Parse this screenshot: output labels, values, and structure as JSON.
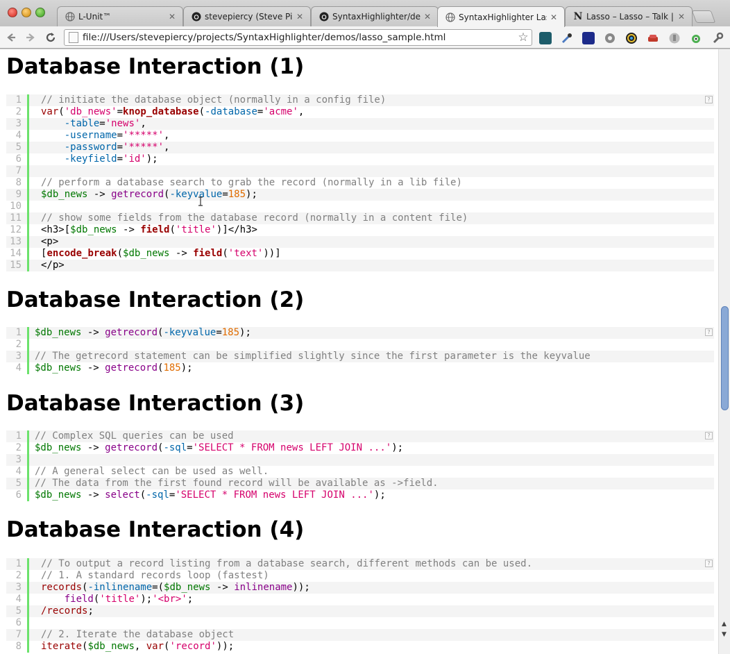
{
  "browser": {
    "tabs": [
      {
        "title": "L-Unit™",
        "icon": "globe-icon"
      },
      {
        "title": "stevepiercy (Steve Piercy)",
        "icon": "github-icon"
      },
      {
        "title": "SyntaxHighlighter/demos",
        "icon": "github-icon"
      },
      {
        "title": "SyntaxHighlighter Lasso",
        "icon": "globe-icon",
        "active": true
      },
      {
        "title": "Lasso – Lasso – Talk | Ma",
        "icon": "n-logo-icon"
      }
    ],
    "url": "file:///Users/stevepiercy/projects/SyntaxHighlighter/demos/lasso_sample.html",
    "close_glyph": "✕",
    "help_glyph": "?"
  },
  "sections": [
    {
      "title": "Database Interaction (1)",
      "lines": [
        [
          [
            "c",
            "// initiate the database object (normally in a config file)"
          ]
        ],
        [
          [
            "k",
            "var"
          ],
          [
            "t",
            "("
          ],
          [
            "s",
            "'db_news'"
          ],
          [
            "t",
            "="
          ],
          [
            "kb",
            "knop_database"
          ],
          [
            "t",
            "("
          ],
          [
            "p",
            "-database"
          ],
          [
            "t",
            "="
          ],
          [
            "s",
            "'acme'"
          ],
          [
            "t",
            ","
          ]
        ],
        [
          [
            "t",
            "    "
          ],
          [
            "p",
            "-table"
          ],
          [
            "t",
            "="
          ],
          [
            "s",
            "'news'"
          ],
          [
            "t",
            ","
          ]
        ],
        [
          [
            "t",
            "    "
          ],
          [
            "p",
            "-username"
          ],
          [
            "t",
            "="
          ],
          [
            "s",
            "'*****'"
          ],
          [
            "t",
            ","
          ]
        ],
        [
          [
            "t",
            "    "
          ],
          [
            "p",
            "-password"
          ],
          [
            "t",
            "="
          ],
          [
            "s",
            "'*****'"
          ],
          [
            "t",
            ","
          ]
        ],
        [
          [
            "t",
            "    "
          ],
          [
            "p",
            "-keyfield"
          ],
          [
            "t",
            "="
          ],
          [
            "s",
            "'id'"
          ],
          [
            "t",
            ");"
          ]
        ],
        [],
        [
          [
            "c",
            "// perform a database search to grab the record (normally in a lib file)"
          ]
        ],
        [
          [
            "v",
            "$db_news"
          ],
          [
            "t",
            " -> "
          ],
          [
            "m",
            "getrecord"
          ],
          [
            "t",
            "("
          ],
          [
            "p",
            "-keyvalue"
          ],
          [
            "t",
            "="
          ],
          [
            "n",
            "185"
          ],
          [
            "t",
            ");"
          ]
        ],
        [],
        [
          [
            "c",
            "// show some fields from the database record (normally in a content file)"
          ]
        ],
        [
          [
            "t",
            "<h3>["
          ],
          [
            "v",
            "$db_news"
          ],
          [
            "t",
            " -> "
          ],
          [
            "kb",
            "field"
          ],
          [
            "t",
            "("
          ],
          [
            "s",
            "'title'"
          ],
          [
            "t",
            ")]</h3>"
          ]
        ],
        [
          [
            "t",
            "<p>"
          ]
        ],
        [
          [
            "t",
            "["
          ],
          [
            "kb",
            "encode_break"
          ],
          [
            "t",
            "("
          ],
          [
            "v",
            "$db_news"
          ],
          [
            "t",
            " -> "
          ],
          [
            "kb",
            "field"
          ],
          [
            "t",
            "("
          ],
          [
            "s",
            "'text'"
          ],
          [
            "t",
            "))]"
          ]
        ],
        [
          [
            "t",
            "</p>"
          ]
        ]
      ]
    },
    {
      "title": "Database Interaction (2)",
      "lines": [
        [
          [
            "v",
            "$db_news"
          ],
          [
            "t",
            " -> "
          ],
          [
            "m",
            "getrecord"
          ],
          [
            "t",
            "("
          ],
          [
            "p",
            "-keyvalue"
          ],
          [
            "t",
            "="
          ],
          [
            "n",
            "185"
          ],
          [
            "t",
            ");"
          ]
        ],
        [],
        [
          [
            "c",
            "// The getrecord statement can be simplified slightly since the first parameter is the keyvalue"
          ]
        ],
        [
          [
            "v",
            "$db_news"
          ],
          [
            "t",
            " -> "
          ],
          [
            "m",
            "getrecord"
          ],
          [
            "t",
            "("
          ],
          [
            "n",
            "185"
          ],
          [
            "t",
            ");"
          ]
        ]
      ]
    },
    {
      "title": "Database Interaction (3)",
      "lines": [
        [
          [
            "c",
            "// Complex SQL queries can be used"
          ]
        ],
        [
          [
            "v",
            "$db_news"
          ],
          [
            "t",
            " -> "
          ],
          [
            "m",
            "getrecord"
          ],
          [
            "t",
            "("
          ],
          [
            "p",
            "-sql"
          ],
          [
            "t",
            "="
          ],
          [
            "s",
            "'SELECT * FROM news LEFT JOIN ...'"
          ],
          [
            "t",
            ");"
          ]
        ],
        [],
        [
          [
            "c",
            "// A general select can be used as well."
          ]
        ],
        [
          [
            "c",
            "// The data from the first found record will be available as ->field."
          ]
        ],
        [
          [
            "v",
            "$db_news"
          ],
          [
            "t",
            " -> "
          ],
          [
            "m",
            "select"
          ],
          [
            "t",
            "("
          ],
          [
            "p",
            "-sql"
          ],
          [
            "t",
            "="
          ],
          [
            "s",
            "'SELECT * FROM news LEFT JOIN ...'"
          ],
          [
            "t",
            ");"
          ]
        ]
      ]
    },
    {
      "title": "Database Interaction (4)",
      "lines": [
        [
          [
            "c",
            "// To output a record listing from a database search, different methods can be used."
          ]
        ],
        [
          [
            "c",
            "// 1. A standard records loop (fastest)"
          ]
        ],
        [
          [
            "k",
            "records"
          ],
          [
            "t",
            "("
          ],
          [
            "p",
            "-inlinename"
          ],
          [
            "t",
            "=("
          ],
          [
            "v",
            "$db_news"
          ],
          [
            "t",
            " -> "
          ],
          [
            "m",
            "inlinename"
          ],
          [
            "t",
            "));"
          ]
        ],
        [
          [
            "t",
            "    "
          ],
          [
            "m",
            "field"
          ],
          [
            "t",
            "("
          ],
          [
            "s",
            "'title'"
          ],
          [
            "t",
            ");"
          ],
          [
            "s",
            "'<br>'"
          ],
          [
            "t",
            ";"
          ]
        ],
        [
          [
            "k",
            "/records"
          ],
          [
            "t",
            ";"
          ]
        ],
        [],
        [
          [
            "c",
            "// 2. Iterate the database object"
          ]
        ],
        [
          [
            "k",
            "iterate"
          ],
          [
            "t",
            "("
          ],
          [
            "v",
            "$db_news"
          ],
          [
            "t",
            ", "
          ],
          [
            "k",
            "var"
          ],
          [
            "t",
            "("
          ],
          [
            "s",
            "'record'"
          ],
          [
            "t",
            "));"
          ]
        ]
      ]
    }
  ]
}
